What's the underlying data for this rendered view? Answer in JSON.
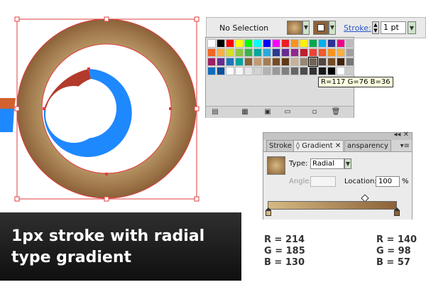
{
  "artwork": {
    "colors": {
      "ring_light": "#d6b982",
      "ring_dark": "#8c6239",
      "arc_blue": "#1e88ff",
      "arc_red": "#b23a2a",
      "selection": "#e23c3c"
    }
  },
  "control_bar": {
    "selection_text": "No Selection",
    "stroke_label": "Stroke:",
    "stroke_weight": "1 pt"
  },
  "swatches": {
    "tooltip": "R=117 G=76 B=36",
    "icons": [
      "swatch-libraries-icon",
      "show-kinds-icon",
      "swatch-options-icon",
      "new-color-group-icon",
      "new-swatch-icon",
      "delete-swatch-icon"
    ],
    "rows": [
      [
        "#ffffff",
        "#000000",
        "#ff0000",
        "#ffff00",
        "#00ff00",
        "#00ffff",
        "#0000ff",
        "#ff00ff",
        "#ee1d24",
        "#f7941d",
        "#fff200",
        "#00a651",
        "#00aeef",
        "#2e3192",
        "#ec008c",
        "#bbbbbb"
      ],
      [
        "#f26522",
        "#fbb040",
        "#d7df23",
        "#8dc63f",
        "#39b54a",
        "#00a99d",
        "#27aae1",
        "#2b3990",
        "#662d91",
        "#92278f",
        "#be1e2d",
        "#ef4136",
        "#f15a29",
        "#f7941e",
        "#fbb040",
        "#a0a0a0"
      ],
      [
        "#9e1f63",
        "#662d91",
        "#1b75bc",
        "#00a79d",
        "#8c6239",
        "#c49a6c",
        "#a67c52",
        "#754c24",
        "#603913",
        "#c7b299",
        "#998675",
        "#736357",
        "#534741",
        "#754c24",
        "#42210b",
        "#777777"
      ],
      [
        "#0d6ebf",
        "#0a4f9a",
        "#ffffff",
        "#f7f7f7",
        "#e6e6e6",
        "#d1d1d1",
        "#b3b3b3",
        "#999999",
        "#808080",
        "#666666",
        "#4d4d4d",
        "#333333",
        "#1a1a1a",
        "#000000",
        "#ffffff",
        "#cccccc"
      ]
    ]
  },
  "gradient_panel": {
    "tabs": [
      "Stroke",
      "Gradient",
      "ansparency"
    ],
    "type_label": "Type:",
    "type_value": "Radial",
    "angle_label": "Angle:",
    "location_label": "Location:",
    "location_value": "100",
    "percent": "%",
    "stop_start_color": "#d6b982",
    "stop_end_color": "#8c6239"
  },
  "caption": {
    "text": "1px stroke with radial type gradient"
  },
  "rgb_values": {
    "start": {
      "r": "R = 214",
      "g": "G = 185",
      "b": "B = 130"
    },
    "end": {
      "r": "R = 140",
      "g": "G = 98",
      "b": "B = 57"
    }
  }
}
